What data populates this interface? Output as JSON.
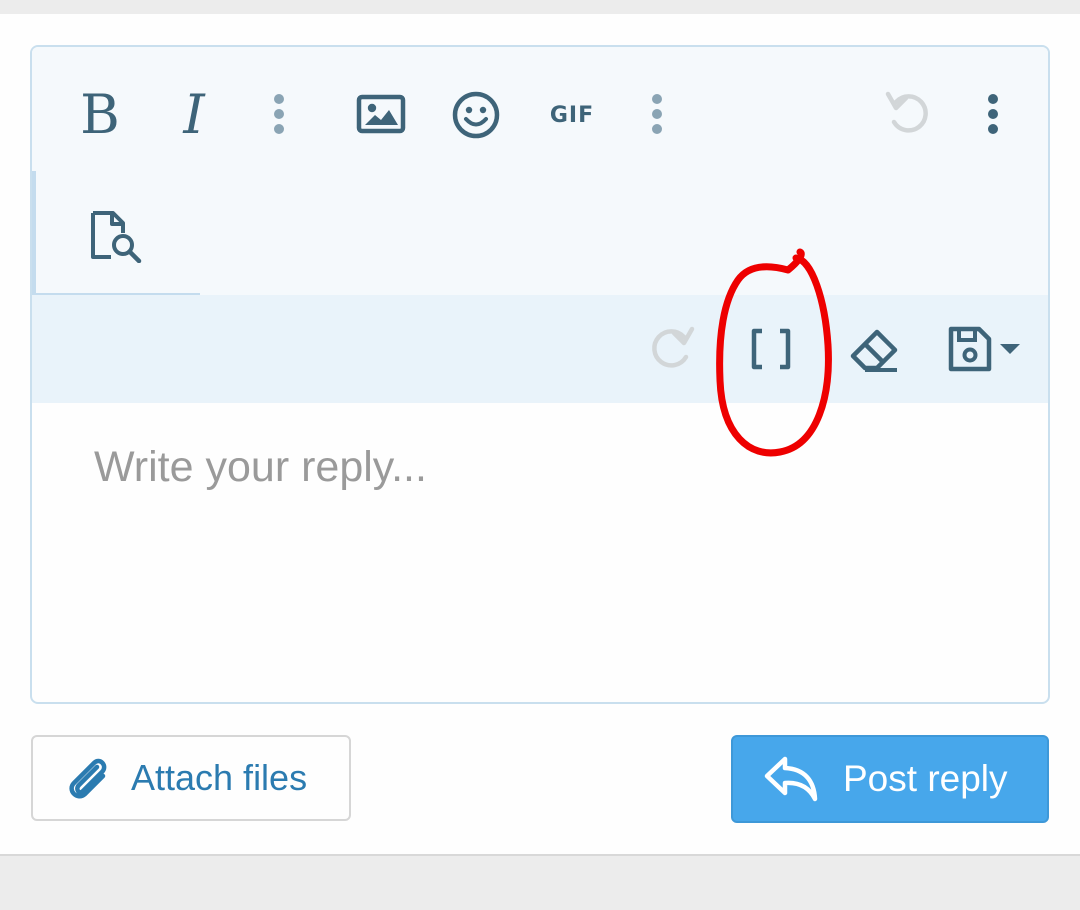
{
  "toolbar": {
    "bold_glyph": "B",
    "italic_glyph": "I",
    "gif_label": "GIF",
    "icons": [
      "bold-icon",
      "italic-icon",
      "more-vertical-icon",
      "image-icon",
      "smiley-icon",
      "gif-icon",
      "more-vertical-icon",
      "undo-icon",
      "more-vertical-icon",
      "preview-icon",
      "redo-icon",
      "brackets-icon",
      "eraser-icon",
      "save-drafts-icon",
      "dropdown-caret-icon"
    ]
  },
  "editor": {
    "placeholder": "Write your reply..."
  },
  "actions": {
    "attach_label": "Attach files",
    "post_label": "Post reply"
  },
  "colors": {
    "icon": "#3e6479",
    "icon_muted": "#8aa4b4",
    "icon_disabled": "#d2d6d8",
    "primary": "#47a7eb",
    "link": "#2b7bb0",
    "annotation": "#ee0000"
  }
}
